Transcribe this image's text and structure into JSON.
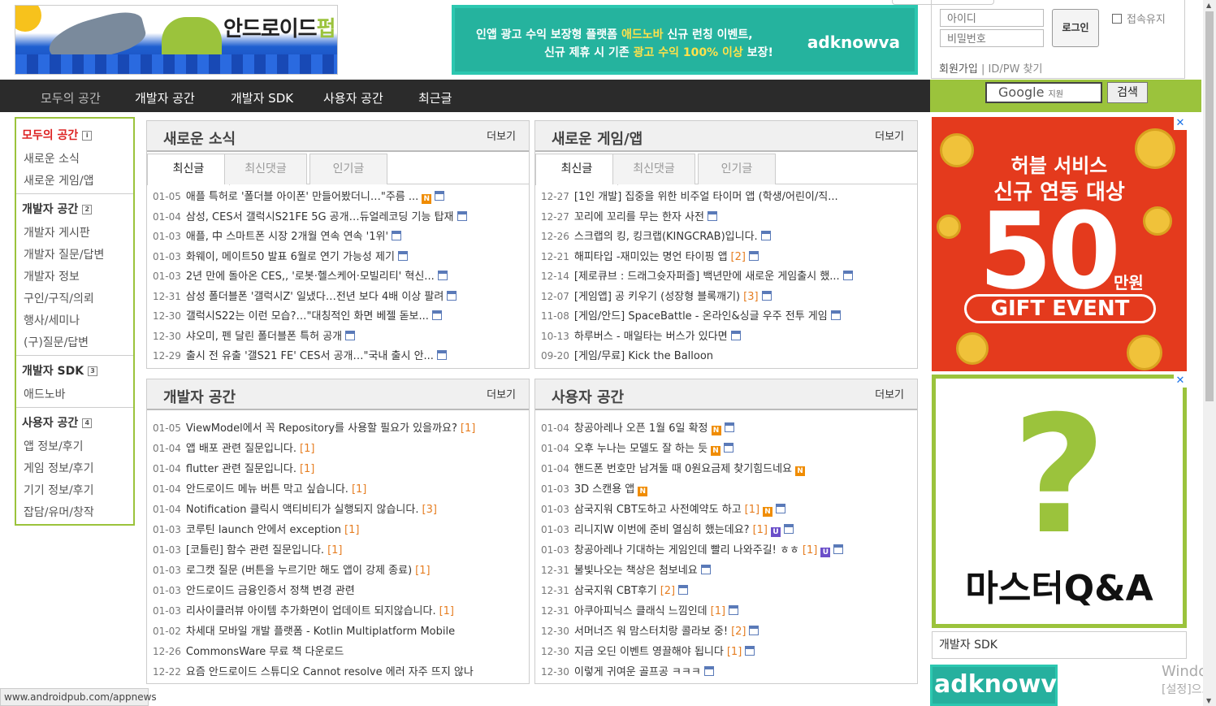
{
  "logo": {
    "text": "안드로이드",
    "accent": "펍"
  },
  "top_ad": {
    "line1a": "인앱 광고 수익 보장형 플랫폼 ",
    "line1b": "애드노바",
    "line1c": " 신규 런칭 이벤트,",
    "line2a": "신규 제휴 시 기존 ",
    "line2b": "광고 수익 100% 이상",
    "line2c": " 보장!",
    "brand": "adknowva"
  },
  "login": {
    "id_placeholder": "아이디",
    "pw_placeholder": "비밀번호",
    "login_button": "로그인",
    "keep_login": "접속유지",
    "signup": "회원가입",
    "find": "ID/PW 찾기"
  },
  "nav": {
    "items": [
      "모두의 공간",
      "개발자 공간",
      "개발자 SDK",
      "사용자 공간",
      "최근글"
    ]
  },
  "search": {
    "google": "Google",
    "google_sub": "지원",
    "button": "검색"
  },
  "sidebar": {
    "sections": [
      {
        "title": "모두의 공간",
        "items": [
          "새로운 소식",
          "새로운 게임/앱"
        ]
      },
      {
        "title": "개발자 공간",
        "items": [
          "개발자 게시판",
          "개발자 질문/답변",
          "개발자 정보",
          "구인/구직/의뢰",
          "행사/세미나",
          "(구)질문/답변"
        ]
      },
      {
        "title": "개발자 SDK",
        "items": [
          "애드노바"
        ]
      },
      {
        "title": "사용자 공간",
        "items": [
          "앱 정보/후기",
          "게임 정보/후기",
          "기기 정보/후기",
          "잡담/유머/창작"
        ]
      }
    ]
  },
  "more_label": "더보기",
  "tab_labels": [
    "최신글",
    "최신댓글",
    "인기글"
  ],
  "news": {
    "title": "새로운 소식",
    "posts": [
      {
        "date": "01-05",
        "title": "애플 특허로 '폴더블 아이폰' 만들어봤더니…\"주름 ...",
        "icons": [
          "n",
          "f"
        ]
      },
      {
        "date": "01-04",
        "title": "삼성, CES서 갤럭시S21FE 5G 공개…듀얼레코딩 기능 탑재",
        "icons": [
          "f"
        ]
      },
      {
        "date": "01-03",
        "title": "애플, 中 스마트폰 시장 2개월 연속 연속 '1위'",
        "icons": [
          "f"
        ]
      },
      {
        "date": "01-03",
        "title": "화웨이, 메이트50 발표 6월로 연기 가능성 제기",
        "icons": [
          "f"
        ]
      },
      {
        "date": "01-03",
        "title": "2년 만에 돌아온 CES,, '로봇·헬스케어·모빌리티' 혁신...",
        "icons": [
          "f"
        ]
      },
      {
        "date": "12-31",
        "title": "삼성 폴더블폰 '갤럭시Z' 일냈다…전년 보다 4배 이상 팔려",
        "icons": [
          "f"
        ]
      },
      {
        "date": "12-30",
        "title": "갤럭시S22는 이런 모습?…\"대칭적인 화면 베젤 돋보...",
        "icons": [
          "f"
        ]
      },
      {
        "date": "12-30",
        "title": "샤오미, 펜 달린 폴더블폰 특허 공개",
        "icons": [
          "f"
        ]
      },
      {
        "date": "12-29",
        "title": "출시 전 유출 '갤S21 FE' CES서 공개…\"국내 출시 안...",
        "icons": [
          "f"
        ]
      }
    ]
  },
  "games": {
    "title": "새로운 게임/앱",
    "posts": [
      {
        "date": "12-27",
        "title": "[1인 개발] 집중을 위한 비주얼 타이머 앱 (학생/어린이/직...",
        "icons": []
      },
      {
        "date": "12-27",
        "title": "꼬리에 꼬리를 무는 한자 사전",
        "icons": [
          "f"
        ]
      },
      {
        "date": "12-26",
        "title": "스크랩의 킹, 킹크랩(KINGCRAB)입니다.",
        "icons": [
          "f"
        ]
      },
      {
        "date": "12-21",
        "title": "해피타입 -재미있는 명언 타이핑 앱",
        "comments": "[2]",
        "icons": [
          "f"
        ]
      },
      {
        "date": "12-14",
        "title": "[제로큐브 : 드래그슛자퍼즐] 백년만에 새로운 게임출시 했...",
        "icons": [
          "f"
        ]
      },
      {
        "date": "12-07",
        "title": "[게임앱] 공 키우기 (성장형 블록깨기)",
        "comments": "[3]",
        "icons": [
          "f"
        ]
      },
      {
        "date": "11-08",
        "title": "[게임/안드] SpaceBattle - 온라인&싱글 우주 전투 게임",
        "icons": [
          "f"
        ]
      },
      {
        "date": "10-13",
        "title": "하루버스 - 매일타는 버스가 있다면",
        "icons": [
          "f"
        ]
      },
      {
        "date": "09-20",
        "title": "[게임/무료] Kick the Balloon",
        "icons": []
      }
    ]
  },
  "dev": {
    "title": "개발자 공간",
    "posts": [
      {
        "date": "01-05",
        "title": "ViewModel에서 꼭 Repository를 사용할 필요가 있을까요?",
        "comments": "[1]"
      },
      {
        "date": "01-04",
        "title": "앱 배포 관련 질문입니다.",
        "comments": "[1]"
      },
      {
        "date": "01-04",
        "title": "flutter 관련 질문입니다.",
        "comments": "[1]"
      },
      {
        "date": "01-04",
        "title": "안드로이드 메뉴 버튼 막고 싶습니다.",
        "comments": "[1]"
      },
      {
        "date": "01-04",
        "title": "Notification 클릭시 액티비티가 실행되지 않습니다.",
        "comments": "[3]"
      },
      {
        "date": "01-03",
        "title": "코루틴 launch 안에서 exception",
        "comments": "[1]"
      },
      {
        "date": "01-03",
        "title": "[코틀린] 함수 관련 질문입니다.",
        "comments": "[1]"
      },
      {
        "date": "01-03",
        "title": "로그캣 질문 (버튼을 누르기만 해도 앱이 강제 종료)",
        "comments": "[1]"
      },
      {
        "date": "01-03",
        "title": "안드로이드 금융인증서 정책 변경 관련",
        "comments": ""
      },
      {
        "date": "01-03",
        "title": "리사이클러뷰 아이템 추가화면이 업데이트 되지않습니다.",
        "comments": "[1]"
      },
      {
        "date": "01-02",
        "title": "차세대 모바일 개발 플랫폼 - Kotlin Multiplatform Mobile",
        "comments": ""
      },
      {
        "date": "12-26",
        "title": "CommonsWare 무료 책 다운로드",
        "comments": ""
      },
      {
        "date": "12-22",
        "title": "요즘 안드로이드 스튜디오 Cannot resolve 에러 자주 뜨지 않나",
        "comments": ""
      }
    ]
  },
  "users": {
    "title": "사용자 공간",
    "posts": [
      {
        "date": "01-04",
        "title": "창공아레나 오픈 1월 6일 확정",
        "comments": "",
        "icons": [
          "n",
          "f"
        ]
      },
      {
        "date": "01-04",
        "title": "오후 누나는 모델도 잘 하는 듯",
        "comments": "",
        "icons": [
          "n",
          "f"
        ]
      },
      {
        "date": "01-04",
        "title": "핸드폰 번호만 남겨둘 때 0원요금제 찾기힘드네요",
        "comments": "",
        "icons": [
          "n"
        ]
      },
      {
        "date": "01-03",
        "title": "3D 스캔용 앱",
        "comments": "",
        "icons": [
          "n"
        ]
      },
      {
        "date": "01-03",
        "title": "삼국지워 CBT도하고 사전예약도 하고",
        "comments": "[1]",
        "icons": [
          "n",
          "f"
        ]
      },
      {
        "date": "01-03",
        "title": "리니지W 이번에 준비 열심히 했는데요?",
        "comments": "[1]",
        "icons": [
          "u",
          "f"
        ]
      },
      {
        "date": "01-03",
        "title": "창공아레나 기대하는 게임인데 빨리 나와주길! ㅎㅎ",
        "comments": "[1]",
        "icons": [
          "u",
          "f"
        ]
      },
      {
        "date": "12-31",
        "title": "불빛나오는 책상은 첨보네요",
        "comments": "",
        "icons": [
          "f"
        ]
      },
      {
        "date": "12-31",
        "title": "삼국지워 CBT후기",
        "comments": "[2]",
        "icons": [
          "f"
        ]
      },
      {
        "date": "12-31",
        "title": "아쿠아피닉스 클래식 느낌인데",
        "comments": "[1]",
        "icons": [
          "f"
        ]
      },
      {
        "date": "12-30",
        "title": "서머너즈 워 맘스터치랑 콜라보 중!",
        "comments": "[2]",
        "icons": [
          "f"
        ]
      },
      {
        "date": "12-30",
        "title": "지금 오딘 이벤트 영끌해야 됩니다",
        "comments": "[1]",
        "icons": [
          "f"
        ]
      },
      {
        "date": "12-30",
        "title": "이렇게 귀여운 골프공 ㅋㅋㅋ",
        "comments": "",
        "icons": [
          "f"
        ]
      }
    ]
  },
  "ad_gift": {
    "line1": "허블 서비스",
    "line2": "신규 연동 대상",
    "amount": "50",
    "unit": "만원",
    "event": "GIFT EVENT"
  },
  "ad_master": {
    "mark": "?",
    "text": "마스터Q&A"
  },
  "sdk_box": "개발자 SDK",
  "adknowva_banner": "adknowva",
  "status_url": "www.androidpub.com/appnews",
  "watermark": {
    "line1": "Windov",
    "line2": "[설정]으로"
  },
  "colors": {
    "accent_green": "#9bc33c",
    "nav_bg": "#2b2b2b",
    "comment_orange": "#e67e22",
    "new_badge": "#f08c00"
  }
}
